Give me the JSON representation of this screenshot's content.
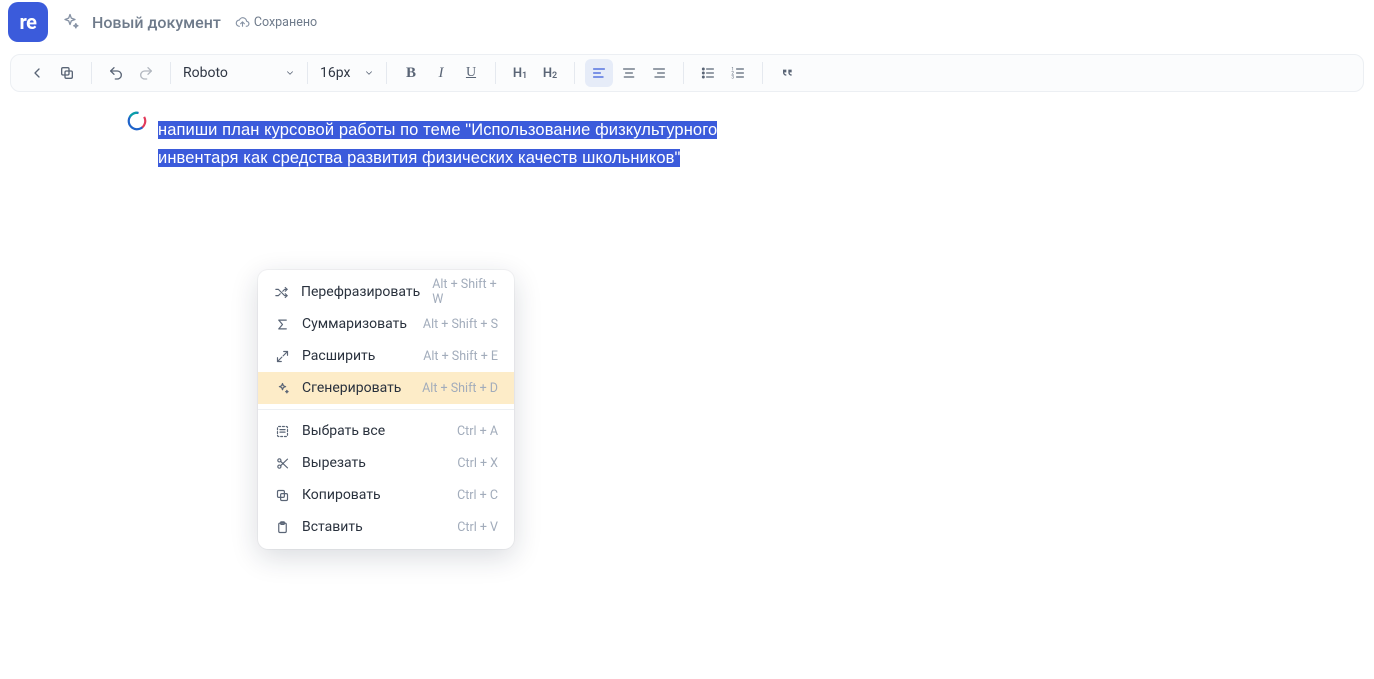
{
  "header": {
    "logo_text": "re",
    "title": "Новый документ",
    "saved_label": "Сохранено"
  },
  "toolbar": {
    "font": "Roboto",
    "size": "16px"
  },
  "document": {
    "selection_text": "напиши план курсовой работы по теме \"Использование физкультурного инвентаря как средства развития физических качеств школьников\""
  },
  "context_menu": {
    "group1": [
      {
        "icon": "shuffle",
        "label": "Перефразировать",
        "shortcut": "Alt + Shift + W",
        "hl": false
      },
      {
        "icon": "sigma",
        "label": "Суммаризовать",
        "shortcut": "Alt + Shift + S",
        "hl": false
      },
      {
        "icon": "expand",
        "label": "Расширить",
        "shortcut": "Alt + Shift + E",
        "hl": false
      },
      {
        "icon": "sparkle",
        "label": "Сгенерировать",
        "shortcut": "Alt + Shift + D",
        "hl": true
      }
    ],
    "group2": [
      {
        "icon": "selectall",
        "label": "Выбрать все",
        "shortcut": "Ctrl + A"
      },
      {
        "icon": "cut",
        "label": "Вырезать",
        "shortcut": "Ctrl + X"
      },
      {
        "icon": "copy",
        "label": "Копировать",
        "shortcut": "Ctrl + C"
      },
      {
        "icon": "paste",
        "label": "Вставить",
        "shortcut": "Ctrl + V"
      }
    ]
  }
}
